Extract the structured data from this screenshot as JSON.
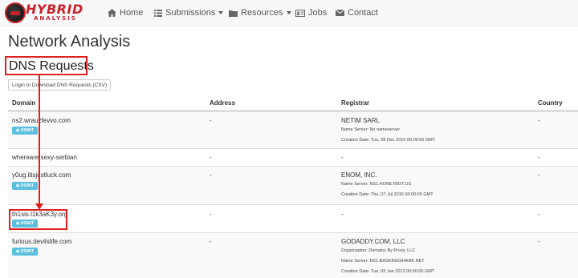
{
  "brand": {
    "name": "HYBRID",
    "sub": "ANALYSIS",
    "accent": "#c8232c"
  },
  "nav": {
    "home": "Home",
    "submissions": "Submissions",
    "resources": "Resources",
    "jobs": "Jobs",
    "contact": "Contact"
  },
  "page_title": "Network Analysis",
  "section_title": "DNS Requests",
  "download_button": "Login to Download DNS Requests (CSV)",
  "columns": {
    "domain": "Domain",
    "address": "Address",
    "registrar": "Registrar",
    "country": "Country"
  },
  "osint_label": "OSINT",
  "osint_color": "#5bc0de",
  "highlight_color": "#e02020",
  "rows": [
    {
      "domain": "ns2.wrauzfevvo.com",
      "address": "-",
      "registrar": "NETIM SARL",
      "details": [
        "Name Server: No nameserver",
        "Creation Date: Tue, 28 Dec 2010 00:00:00 GMT"
      ],
      "country": "-"
    },
    {
      "domain": "whereare.sexy-serbian",
      "address": "-",
      "registrar": "-",
      "details": [],
      "country": "-"
    },
    {
      "domain": "y0ug.itisjustluck.com",
      "address": "-",
      "registrar": "ENOM, INC.",
      "details": [
        "Name Server: NS1.HONEYBOT.US",
        "Creation Date: Thu, 07 Jul 2016 00:00:00 GMT"
      ],
      "country": "-"
    },
    {
      "domain": "th1sis.l1k3aK3y.org",
      "address": "-",
      "registrar": "-",
      "details": [],
      "country": "-"
    },
    {
      "domain": "furious.devilslife.com",
      "address": "-",
      "registrar": "GODADDY.COM, LLC",
      "details": [
        "Organization: Domains By Proxy, LLC",
        "Name Server: NS1.BASKINGSHARK.NET",
        "Creation Date: Tue, 03 Jan 2012 00:00:00 GMT"
      ],
      "country": "-"
    }
  ]
}
